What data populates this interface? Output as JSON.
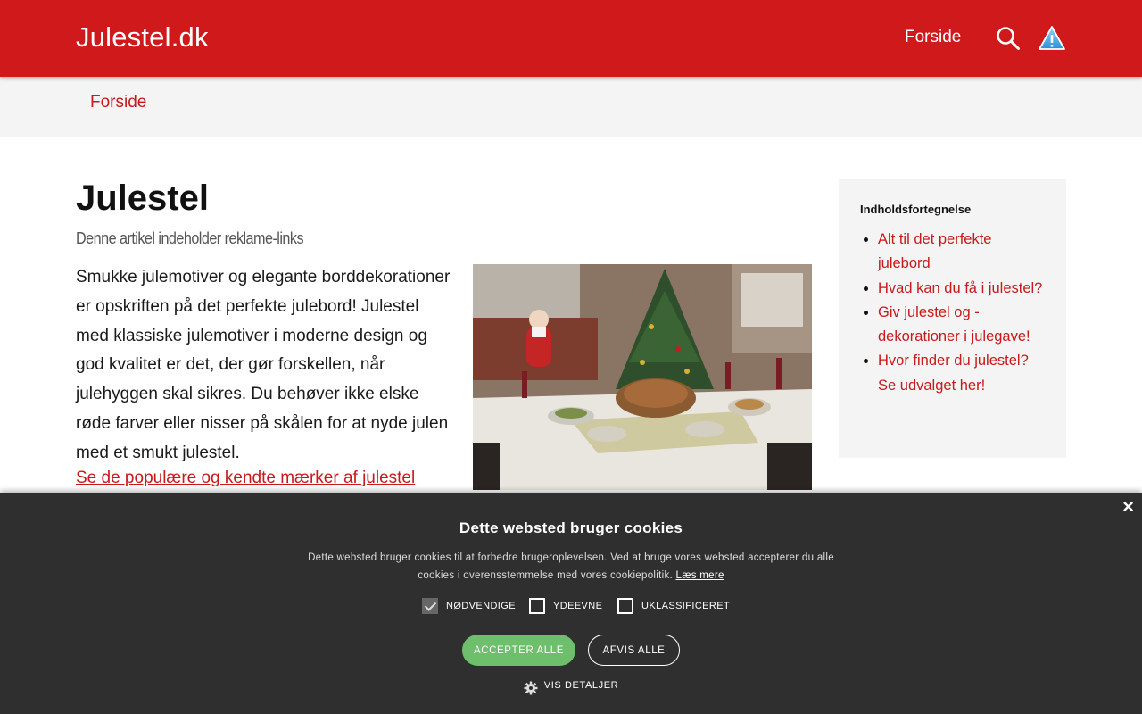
{
  "header": {
    "site_name": "Julestel.dk",
    "nav_home": "Forside",
    "icons": [
      "search-icon",
      "warning-icon"
    ]
  },
  "breadcrumb": {
    "home": "Forside"
  },
  "article": {
    "title": "Julestel",
    "ad_notice": "Denne artikel indeholder reklame-links",
    "intro": "Smukke julemotiver og elegante borddekorationer er opskriften på det perfekte julebord! Julestel med klassiske julemotiver i moderne design og god kvalitet er det, der gør forskellen, når julehyggen skal sikres. Du behøver ikke elske røde farver eller nisser på skålen for at nyde julen med et smukt julestel.",
    "brands_link": "Se de populære og kendte mærker af julestel"
  },
  "toc": {
    "title": "Indholdsfortegnelse",
    "items": [
      {
        "label": "Alt til det perfekte julebord"
      },
      {
        "label": "Hvad kan du få i julestel?"
      },
      {
        "label": "Giv julestel og -dekorationer i julegave!"
      },
      {
        "label": "Hvor finder du julestel? Se udvalget her!"
      }
    ]
  },
  "cookie": {
    "title": "Dette websted bruger cookies",
    "text": "Dette websted bruger cookies til at forbedre brugeroplevelsen. Ved at bruge vores websted accepterer du alle cookies i overensstemmelse med vores cookiepolitik.",
    "read_more": "Læs mere",
    "options": [
      {
        "label": "NØDVENDIGE",
        "checked": true
      },
      {
        "label": "YDEEVNE",
        "checked": false
      },
      {
        "label": "UKLASSIFICERET",
        "checked": false
      }
    ],
    "accept_all": "ACCEPTER ALLE",
    "reject_all": "AFVIS ALLE",
    "show_details": "VIS DETALJER",
    "close_symbol": "×"
  },
  "colors": {
    "brand_red": "#d0191b",
    "link_red": "#c8191b",
    "cookie_bg": "#2f2f2f",
    "accept_green": "#6ebf6b"
  }
}
